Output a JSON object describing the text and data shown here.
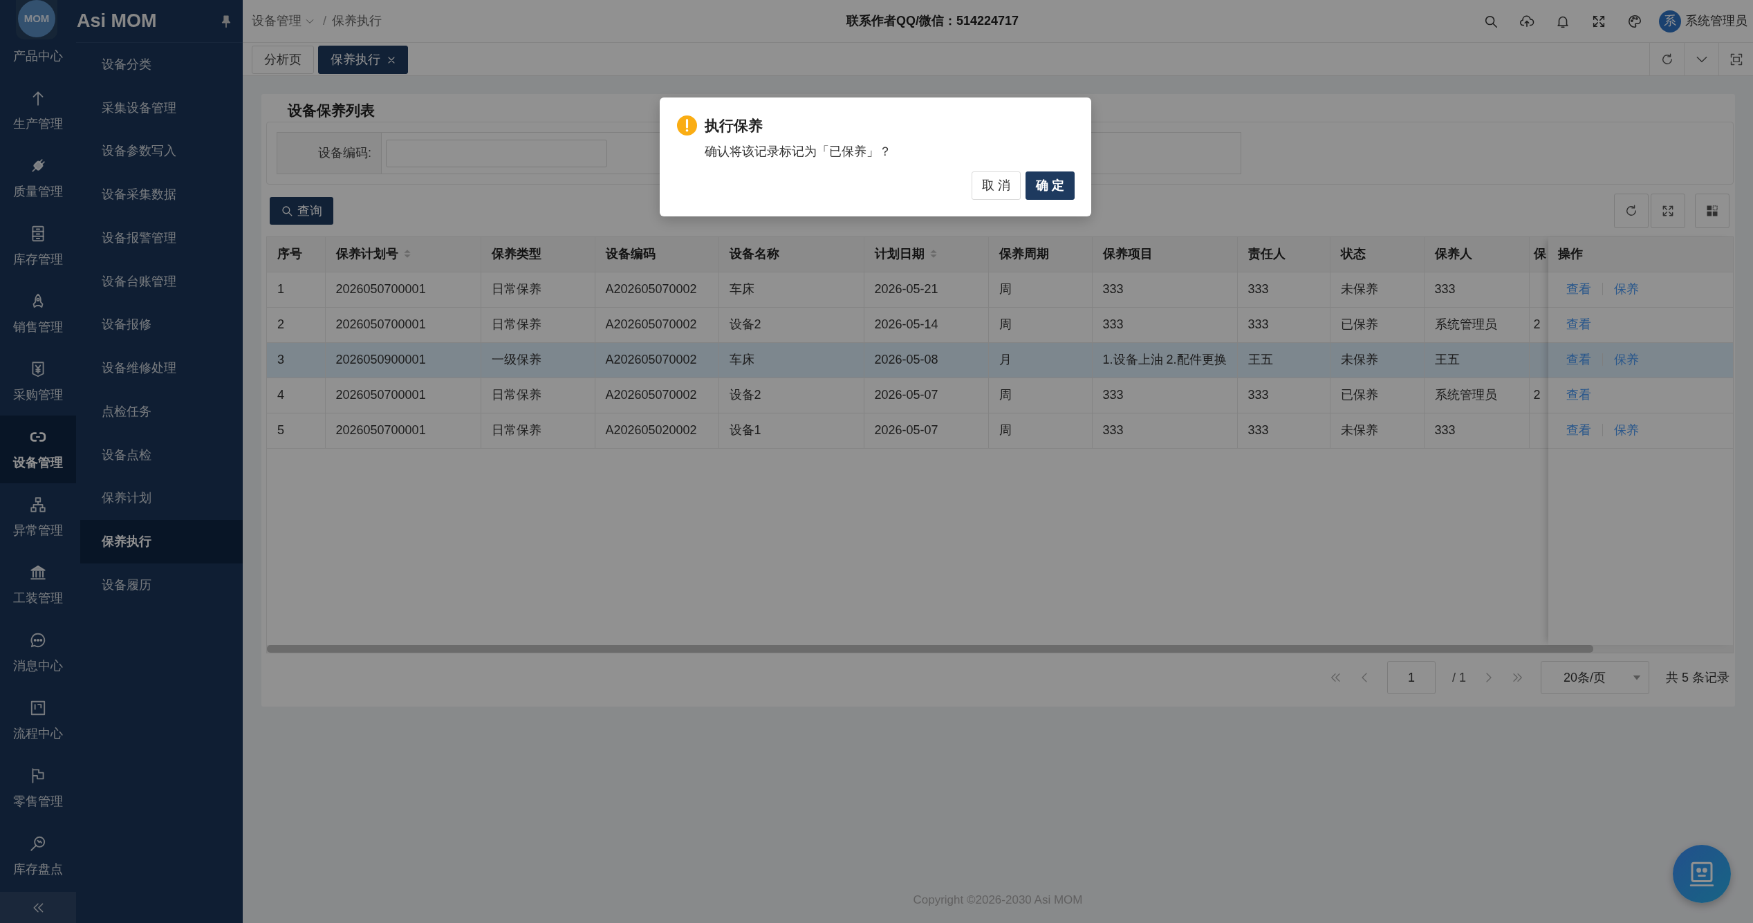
{
  "app": {
    "logo_text": "MOM",
    "title": "Asi MOM"
  },
  "rail": [
    {
      "label": "产品中心",
      "selected": false
    },
    {
      "label": "生产管理",
      "selected": false
    },
    {
      "label": "质量管理",
      "selected": false
    },
    {
      "label": "库存管理",
      "selected": false
    },
    {
      "label": "销售管理",
      "selected": false
    },
    {
      "label": "采购管理",
      "selected": false
    },
    {
      "label": "设备管理",
      "selected": true
    },
    {
      "label": "异常管理",
      "selected": false
    },
    {
      "label": "工装管理",
      "selected": false
    },
    {
      "label": "消息中心",
      "selected": false
    },
    {
      "label": "流程中心",
      "selected": false
    },
    {
      "label": "零售管理",
      "selected": false
    },
    {
      "label": "库存盘点",
      "selected": false
    }
  ],
  "menu": [
    {
      "label": "设备分类",
      "selected": false
    },
    {
      "label": "采集设备管理",
      "selected": false
    },
    {
      "label": "设备参数写入",
      "selected": false
    },
    {
      "label": "设备采集数据",
      "selected": false
    },
    {
      "label": "设备报警管理",
      "selected": false
    },
    {
      "label": "设备台账管理",
      "selected": false
    },
    {
      "label": "设备报修",
      "selected": false
    },
    {
      "label": "设备维修处理",
      "selected": false
    },
    {
      "label": "点检任务",
      "selected": false
    },
    {
      "label": "设备点检",
      "selected": false
    },
    {
      "label": "保养计划",
      "selected": false
    },
    {
      "label": "保养执行",
      "selected": true
    },
    {
      "label": "设备履历",
      "selected": false
    }
  ],
  "header": {
    "breadcrumb": {
      "separator": "/",
      "items": [
        {
          "label": "设备管理",
          "dropdown": true
        },
        {
          "label": "保养执行",
          "dropdown": false
        }
      ]
    },
    "notice": "联系作者QQ/微信：514224717",
    "user": {
      "avatar_text": "系",
      "name": "系统管理员"
    }
  },
  "tabs": [
    {
      "label": "分析页",
      "selected": false,
      "closable": false
    },
    {
      "label": "保养执行",
      "selected": true,
      "closable": true
    }
  ],
  "panel": {
    "title": "设备保养列表",
    "filters": [
      {
        "label": "设备编码:"
      }
    ],
    "search_button": "查询"
  },
  "table": {
    "columns": [
      {
        "label": "序号",
        "sortable": false
      },
      {
        "label": "保养计划号",
        "sortable": true
      },
      {
        "label": "保养类型",
        "sortable": false
      },
      {
        "label": "设备编码",
        "sortable": false
      },
      {
        "label": "设备名称",
        "sortable": false
      },
      {
        "label": "计划日期",
        "sortable": true
      },
      {
        "label": "保养周期",
        "sortable": false
      },
      {
        "label": "保养项目",
        "sortable": false
      },
      {
        "label": "责任人",
        "sortable": false
      },
      {
        "label": "状态",
        "sortable": false
      },
      {
        "label": "保养人",
        "sortable": false
      }
    ],
    "overflow_column": "保",
    "action_column": "操作",
    "rows": [
      {
        "selected": false,
        "cells": [
          "1",
          "2026050700001",
          "日常保养",
          "A202605070002",
          "车床",
          "2026-05-21",
          "周",
          "333",
          "333",
          "未保养",
          "333"
        ],
        "actions": [
          "查看",
          "保养"
        ]
      },
      {
        "selected": false,
        "cells": [
          "2",
          "2026050700001",
          "日常保养",
          "A202605070002",
          "设备2",
          "2026-05-14",
          "周",
          "333",
          "333",
          "已保养",
          "系统管理员"
        ],
        "overflow_cell": "2",
        "actions": [
          "查看"
        ]
      },
      {
        "selected": true,
        "cells": [
          "3",
          "2026050900001",
          "一级保养",
          "A202605070002",
          "车床",
          "2026-05-08",
          "月",
          "1.设备上油 2.配件更换",
          "王五",
          "未保养",
          "王五"
        ],
        "actions": [
          "查看",
          "保养"
        ]
      },
      {
        "selected": false,
        "cells": [
          "4",
          "2026050700001",
          "日常保养",
          "A202605070002",
          "设备2",
          "2026-05-07",
          "周",
          "333",
          "333",
          "已保养",
          "系统管理员"
        ],
        "overflow_cell": "2",
        "actions": [
          "查看"
        ]
      },
      {
        "selected": false,
        "cells": [
          "5",
          "2026050700001",
          "日常保养",
          "A202605020002",
          "设备1",
          "2026-05-07",
          "周",
          "333",
          "333",
          "未保养",
          "333"
        ],
        "actions": [
          "查看",
          "保养"
        ]
      }
    ]
  },
  "pagination": {
    "page": "1",
    "total_pages": "/ 1",
    "page_size": "20条/页",
    "total": "共 5 条记录"
  },
  "footer": "Copyright ©2026-2030 Asi MOM",
  "dialog": {
    "title": "执行保养",
    "message": "确认将该记录标记为「已保养」？",
    "buttons": [
      {
        "label": "取 消",
        "kind": "default"
      },
      {
        "label": "确 定",
        "kind": "primary"
      }
    ]
  }
}
